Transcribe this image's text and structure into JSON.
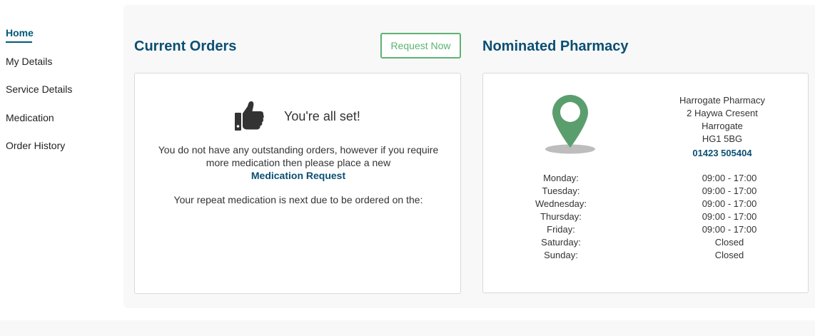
{
  "sidebar": {
    "items": [
      {
        "label": "Home",
        "active": true
      },
      {
        "label": "My Details"
      },
      {
        "label": "Service Details"
      },
      {
        "label": "Medication"
      },
      {
        "label": "Order History"
      }
    ]
  },
  "orders": {
    "title": "Current Orders",
    "request_button": "Request Now",
    "status_heading": "You're all set!",
    "message": "You do not have any outstanding orders, however if you require more medication then please place a new",
    "link": "Medication Request",
    "next_due": "Your repeat medication is next due to be ordered on the:"
  },
  "pharmacy": {
    "title": "Nominated Pharmacy",
    "name": "Harrogate Pharmacy",
    "address_line1": "2 Haywa Cresent",
    "town": "Harrogate",
    "postcode": "HG1 5BG",
    "phone": "01423 505404",
    "hours": [
      {
        "day": "Monday:",
        "time": "09:00 - 17:00"
      },
      {
        "day": "Tuesday:",
        "time": "09:00 - 17:00"
      },
      {
        "day": "Wednesday:",
        "time": "09:00 - 17:00"
      },
      {
        "day": "Thursday:",
        "time": "09:00 - 17:00"
      },
      {
        "day": "Friday:",
        "time": "09:00 - 17:00"
      },
      {
        "day": "Saturday:",
        "time": "Closed"
      },
      {
        "day": "Sunday:",
        "time": "Closed"
      }
    ]
  },
  "colors": {
    "accent_blue": "#0b4f72",
    "accent_green": "#5cb371",
    "pin_green": "#5b9e6e"
  }
}
